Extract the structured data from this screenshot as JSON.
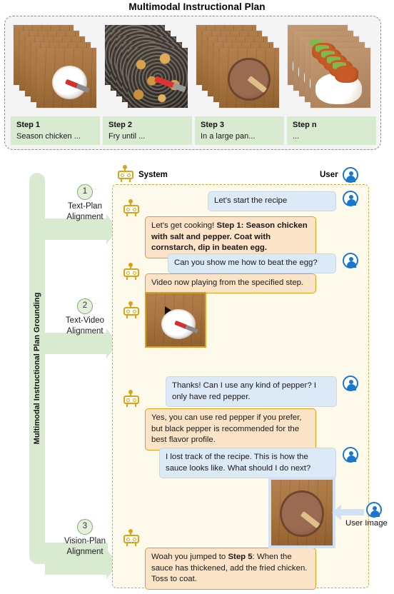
{
  "title": "Multimodal Instructional Plan",
  "plan": {
    "steps": [
      {
        "name": "Step 1",
        "desc": "Season chicken ...",
        "image": "bowl-cornstarch-thumbnail"
      },
      {
        "name": "Step 2",
        "desc": "Fry until ...",
        "image": "frying-chicken-thumbnail"
      },
      {
        "name": "Step 3",
        "desc": "In a large pan...",
        "image": "sauce-pan-thumbnail"
      },
      {
        "name": "Step n",
        "desc": "...",
        "image": "plated-rice-chicken-thumbnail"
      }
    ]
  },
  "grounding": {
    "bar_label": "Multimodal Instructional Plan Grounding",
    "alignments": [
      {
        "num": "1",
        "line1": "Text-Plan",
        "line2": "Alignment"
      },
      {
        "num": "2",
        "line1": "Text-Video",
        "line2": "Alignment"
      },
      {
        "num": "3",
        "line1": "Vision-Plan",
        "line2": "Alignment"
      }
    ]
  },
  "chat": {
    "system_label": "System",
    "user_label": "User",
    "messages": [
      {
        "role": "user",
        "text": "Let's start the recipe"
      },
      {
        "role": "system",
        "text_plain": "Let's get cooking! ",
        "text_bold": "Step 1: Season chicken with salt and pepper. Coat with cornstarch, dip in beaten egg."
      },
      {
        "role": "user",
        "text": "Can you show me how to beat the egg?"
      },
      {
        "role": "system",
        "text": "Video now playing from the specified step."
      },
      {
        "role": "system",
        "media": "video-thumbnail-play-button"
      },
      {
        "role": "user",
        "text": "Thanks! Can I use any kind of pepper? I only have red pepper."
      },
      {
        "role": "system",
        "text": "Yes, you can use red pepper if you prefer, but black pepper is recommended for the best flavor profile."
      },
      {
        "role": "user",
        "text": "I lost track of the recipe. This is how the sauce looks like. What should I do next?"
      },
      {
        "role": "user",
        "media": "user-uploaded-sauce-pan-photo"
      },
      {
        "role": "system",
        "text_pre": "Woah you jumped to ",
        "text_bold": "Step 5",
        "text_post": ": When the sauce has thickened, add the fried chicken. Toss to coat."
      }
    ]
  },
  "user_image": {
    "label": "User Image"
  },
  "colors": {
    "green_panel": "#d8ead0",
    "system_bubble": "#fbe3c8",
    "system_border": "#d9a21c",
    "user_bubble": "#dce9f7",
    "user_accent": "#1878d0",
    "chat_panel_bg": "#fdfaec",
    "plan_panel_bg": "#f4f4f4"
  }
}
